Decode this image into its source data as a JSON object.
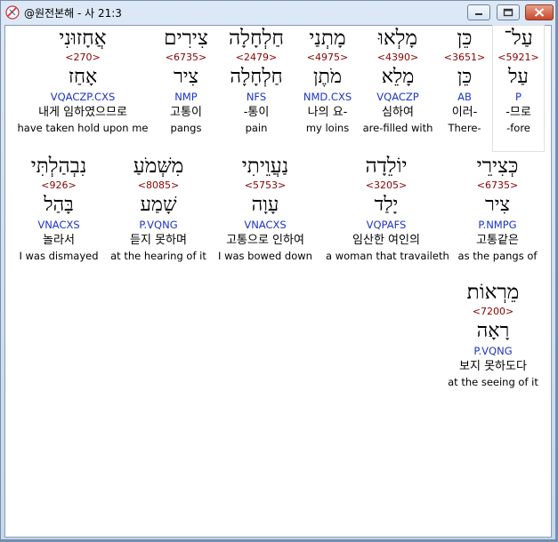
{
  "window": {
    "title": "@원전본해 - 사 21:3"
  },
  "rows": [
    [
      {
        "heb": "עַל־",
        "code": "<5921>",
        "lemma": "עַל",
        "parse": "P",
        "kor": "-므로",
        "eng": "-fore"
      },
      {
        "heb": "כֵּן",
        "code": "<3651>",
        "lemma": "כֵּן",
        "parse": "AB",
        "kor": "이러-",
        "eng": "There-"
      },
      {
        "heb": "מָלְאוּ",
        "code": "<4390>",
        "lemma": "מָלֵא",
        "parse": "VQACZP",
        "kor": "심하여",
        "eng": "are-filled with"
      },
      {
        "heb": "מָתְנַי",
        "code": "<4975>",
        "lemma": "מֹתֶן",
        "parse": "NMD.CXS",
        "kor": "나의 요-",
        "eng": "my loins"
      },
      {
        "heb": "חַלְחָלָה",
        "code": "<2479>",
        "lemma": "חַלְחָלָה",
        "parse": "NFS",
        "kor": "-통이",
        "eng": "pain"
      },
      {
        "heb": "צִירִים",
        "code": "<6735>",
        "lemma": "צִיר",
        "parse": "NMP",
        "kor": "고통이",
        "eng": "pangs"
      },
      {
        "heb": "אֲחָזוּנִי",
        "code": "<270>",
        "lemma": "אָחַז",
        "parse": "VQACZP.CXS",
        "kor": "내게 임하였으므로",
        "eng": "have taken hold upon me"
      }
    ],
    [
      {
        "heb": "כְּצִירֵי",
        "code": "<6735>",
        "lemma": "צִיר",
        "parse": "P.NMPG",
        "kor": "고통같은",
        "eng": "as the pangs of"
      },
      {
        "heb": "יוֹלֵדָה",
        "code": "<3205>",
        "lemma": "יָלַד",
        "parse": "VQPAFS",
        "kor": "임산한 여인의",
        "eng": "a woman that travaileth"
      },
      {
        "heb": "נַעֲוֵיתִי",
        "code": "<5753>",
        "lemma": "עָוָה",
        "parse": "VNACXS",
        "kor": "고통으로 인하여",
        "eng": "I was bowed down"
      },
      {
        "heb": "מִשְּׁמֹעַ",
        "code": "<8085>",
        "lemma": "שָׁמַע",
        "parse": "P.VQNG",
        "kor": "듣지 못하며",
        "eng": "at the hearing of it"
      },
      {
        "heb": "נִבְהַלְתִּי",
        "code": "<926>",
        "lemma": "בָּהַל",
        "parse": "VNACXS",
        "kor": "놀라서",
        "eng": "I was dismayed"
      }
    ],
    [
      {
        "heb": "מֵרְאוֹת׃",
        "code": "<7200>",
        "lemma": "רָאָה",
        "parse": "P.VQNG",
        "kor": "보지 못하도다",
        "eng": "at the seeing of it"
      }
    ]
  ]
}
